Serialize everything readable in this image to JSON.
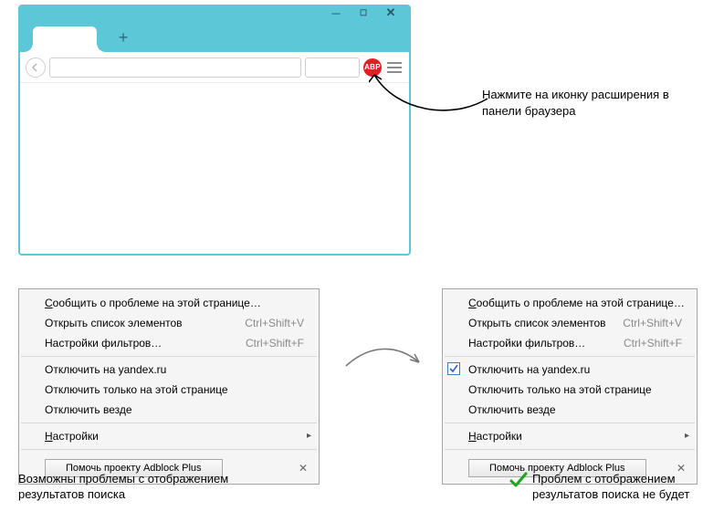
{
  "abp_label": "ABP",
  "callout": "Нажмите на иконку расширения в панели браузера",
  "menu": {
    "report": {
      "prefix": "С",
      "rest": "ообщить о проблеме на этой странице…"
    },
    "open_list": {
      "label": "Открыть список элементов",
      "shortcut": "Ctrl+Shift+V"
    },
    "filters": {
      "label": "Настройки фильтров…",
      "shortcut": "Ctrl+Shift+F"
    },
    "disable_site": {
      "label": "Отключить на yandex.ru"
    },
    "disable_page": {
      "label": "Отключить только на этой странице"
    },
    "disable_all": {
      "label": "Отключить везде"
    },
    "settings": {
      "prefix": "Н",
      "rest": "астройки"
    },
    "help_btn": "Помочь проекту Adblock Plus"
  },
  "caption_left": "Возможны проблемы с отображением результатов поиска",
  "caption_right": "Проблем с отображением результатов поиска не будет"
}
